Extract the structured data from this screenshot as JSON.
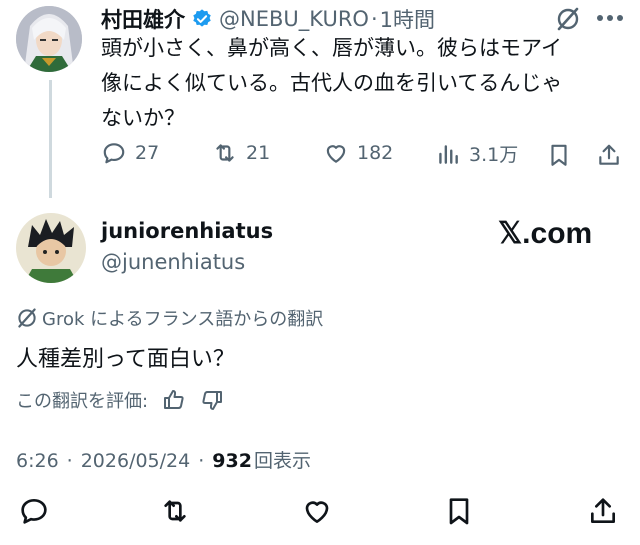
{
  "quoted_tweet": {
    "author_name": "村田雄介",
    "author_handle": "@NEBU_KURO",
    "separator": "·",
    "time_ago": "1時間",
    "text_line1": "頭が小さく、鼻が高く、唇が薄い。彼らはモアイ",
    "text_line2": "像によく似ている。古代人の血を引いてるんじゃ",
    "text_line3": "ないか？",
    "replies": "27",
    "reposts": "21",
    "likes": "182",
    "views": "3.1万"
  },
  "main_tweet": {
    "author_name": "juniorenhiatus",
    "author_handle": "@junenhiatus",
    "watermark": "𝕏.com",
    "translation_label": "Grok によるフランス語からの翻訳",
    "text": "人種差別って面白い？",
    "rate_label": "この翻訳を評価:",
    "time": "6:26",
    "date": "2026/05/24",
    "view_count": "932",
    "views_label": "回表示",
    "dot": "·"
  },
  "colors": {
    "verified": "#1d9bf0",
    "secondary_text": "#536471",
    "thread_line": "#cfd9de"
  },
  "icons": [
    "verified-badge-icon",
    "grok-icon",
    "more-icon",
    "reply-icon",
    "repost-icon",
    "like-icon",
    "views-icon",
    "bookmark-icon",
    "share-icon",
    "thumbs-up-icon",
    "thumbs-down-icon"
  ]
}
